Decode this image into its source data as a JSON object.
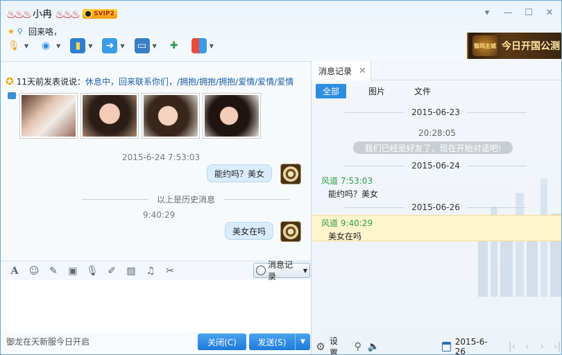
{
  "header": {
    "nickname": "小冉",
    "vip_badge": "SVIP2",
    "status_text": "回来咯，"
  },
  "banner": {
    "logo_text": "御风主城",
    "text": "今日开国公测"
  },
  "feed": {
    "prefix": "11天前发表说说：",
    "text": "休息中，回来联系你们，/拥抱/拥抱/拥抱/爱情/爱情/爱情"
  },
  "chat": {
    "timestamp1": "2015-6-24 7:53:03",
    "msg1": "能约吗？美女",
    "history_divider": "以上是历史消息",
    "timestamp2": "9:40:29",
    "msg2": "美女在吗"
  },
  "input_toolbar": {
    "record_button": "消息记录"
  },
  "footer": {
    "left_text": "御龙在天新服今日开启",
    "close_button": "关闭(C)",
    "send_button": "发送(S)"
  },
  "history": {
    "tab_label": "消息记录",
    "filters": [
      "全部",
      "图片",
      "文件"
    ],
    "date1": "2015-06-23",
    "sys_time": "20:28:05",
    "sys_msg": "我们已经是好友了，现在开始对话吧!",
    "date2": "2015-06-24",
    "rec1_name": "风道 7:53:03",
    "rec1_text": "能约吗？美女",
    "date3": "2015-06-26",
    "rec2_name": "风道 9:40:29",
    "rec2_text": "美女在吗",
    "settings_label": "设置",
    "current_date": "2015-6-26"
  },
  "colors": {
    "accent": "#2e8de0",
    "bubble": "#d8ecfb",
    "sender_name": "#2c9c4a"
  }
}
